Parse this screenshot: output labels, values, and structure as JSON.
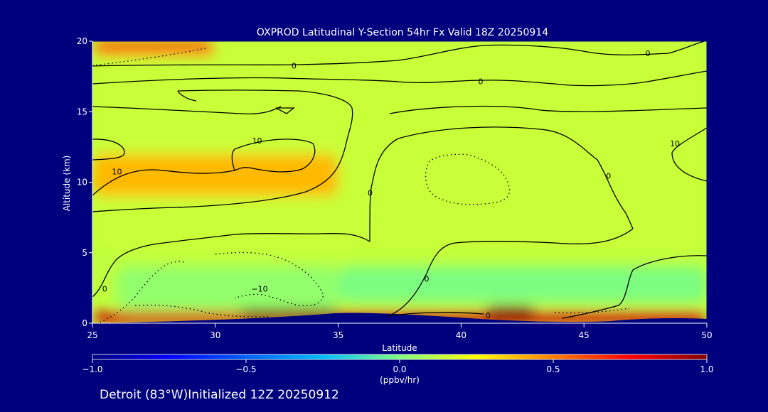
{
  "chart_data": {
    "type": "heatmap",
    "title": "OXPROD Latitudinal Y-Section 54hr  Fx Valid 18Z 20250914",
    "xlabel": "Latitude",
    "ylabel": "Altitude (km)",
    "xlim": [
      25,
      50
    ],
    "ylim": [
      0,
      20
    ],
    "x_ticks": [
      25,
      30,
      35,
      40,
      45,
      50
    ],
    "y_ticks": [
      0,
      5,
      10,
      15,
      20
    ],
    "colorbar": {
      "range": [
        -1.0,
        1.0
      ],
      "ticks": [
        -1.0,
        -0.5,
        0.0,
        0.5,
        1.0
      ],
      "tick_labels": [
        "−1.0",
        "−0.5",
        "0.0",
        "0.5",
        "1.0"
      ],
      "label": "(ppbv/hr)",
      "colormap": [
        "#00007f",
        "#0000ff",
        "#00bfff",
        "#7fff7f",
        "#ffff00",
        "#ff7f00",
        "#ff0000",
        "#7f0000"
      ]
    },
    "field_value": 0.0,
    "field_regions": [
      {
        "lat": [
          25,
          50
        ],
        "alt": [
          5,
          20
        ],
        "value": 0.02
      },
      {
        "lat": [
          25,
          35
        ],
        "alt": [
          9,
          12
        ],
        "value": 0.3
      },
      {
        "lat": [
          25,
          30
        ],
        "alt": [
          19,
          20
        ],
        "value": 0.5
      },
      {
        "lat": [
          26,
          35
        ],
        "alt": [
          1,
          4
        ],
        "value": -0.1
      },
      {
        "lat": [
          35,
          50
        ],
        "alt": [
          1.5,
          4
        ],
        "value": -0.15
      },
      {
        "lat": [
          25,
          50
        ],
        "alt": [
          0,
          0.8
        ],
        "value": 0.8
      },
      {
        "lat": [
          31,
          35
        ],
        "alt": [
          0.3,
          1
        ],
        "value": 1.0
      },
      {
        "lat": [
          41,
          43
        ],
        "alt": [
          0.3,
          1.2
        ],
        "value": 1.0
      }
    ],
    "contour_labels": [
      {
        "text": "0",
        "lat": 33.2,
        "alt": 18.2
      },
      {
        "text": "0",
        "lat": 40.8,
        "alt": 17.1
      },
      {
        "text": "0",
        "lat": 47.6,
        "alt": 19.1
      },
      {
        "text": "10",
        "lat": 26.0,
        "alt": 10.7
      },
      {
        "text": "10",
        "lat": 31.7,
        "alt": 12.9
      },
      {
        "text": "10",
        "lat": 48.7,
        "alt": 12.7
      },
      {
        "text": "0",
        "lat": 25.5,
        "alt": 2.4
      },
      {
        "text": "−10",
        "lat": 31.8,
        "alt": 2.4
      },
      {
        "text": "0",
        "lat": 38.6,
        "alt": 3.1
      },
      {
        "text": "0",
        "lat": 36.3,
        "alt": 9.2
      },
      {
        "text": "0",
        "lat": 46.0,
        "alt": 10.4
      },
      {
        "text": "0",
        "lat": 41.1,
        "alt": 0.5
      }
    ]
  },
  "footer": {
    "location_text": "Detroit (83°W)Initialized 12Z 20250912"
  }
}
